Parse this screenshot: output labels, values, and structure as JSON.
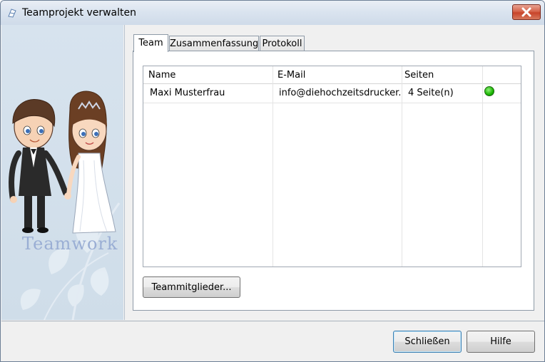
{
  "window": {
    "title": "Teamprojekt verwalten",
    "close_symbol": "×"
  },
  "sidebar": {
    "caption": "Teamwork",
    "illustration": "bride-and-groom"
  },
  "tabs": [
    {
      "label": "Team",
      "active": true
    },
    {
      "label": "Zusammenfassung",
      "active": false
    },
    {
      "label": "Protokoll",
      "active": false
    }
  ],
  "team_table": {
    "columns": [
      "Name",
      "E-Mail",
      "Seiten",
      ""
    ],
    "rows": [
      {
        "name": "Maxi Musterfrau",
        "email": "info@diehochzeitsdrucker...",
        "pages": "4 Seite(n)",
        "status": "online",
        "status_color": "#19b500"
      }
    ]
  },
  "buttons": {
    "team_members": "Teammitglieder...",
    "close": "Schließen",
    "help": "Hilfe"
  }
}
